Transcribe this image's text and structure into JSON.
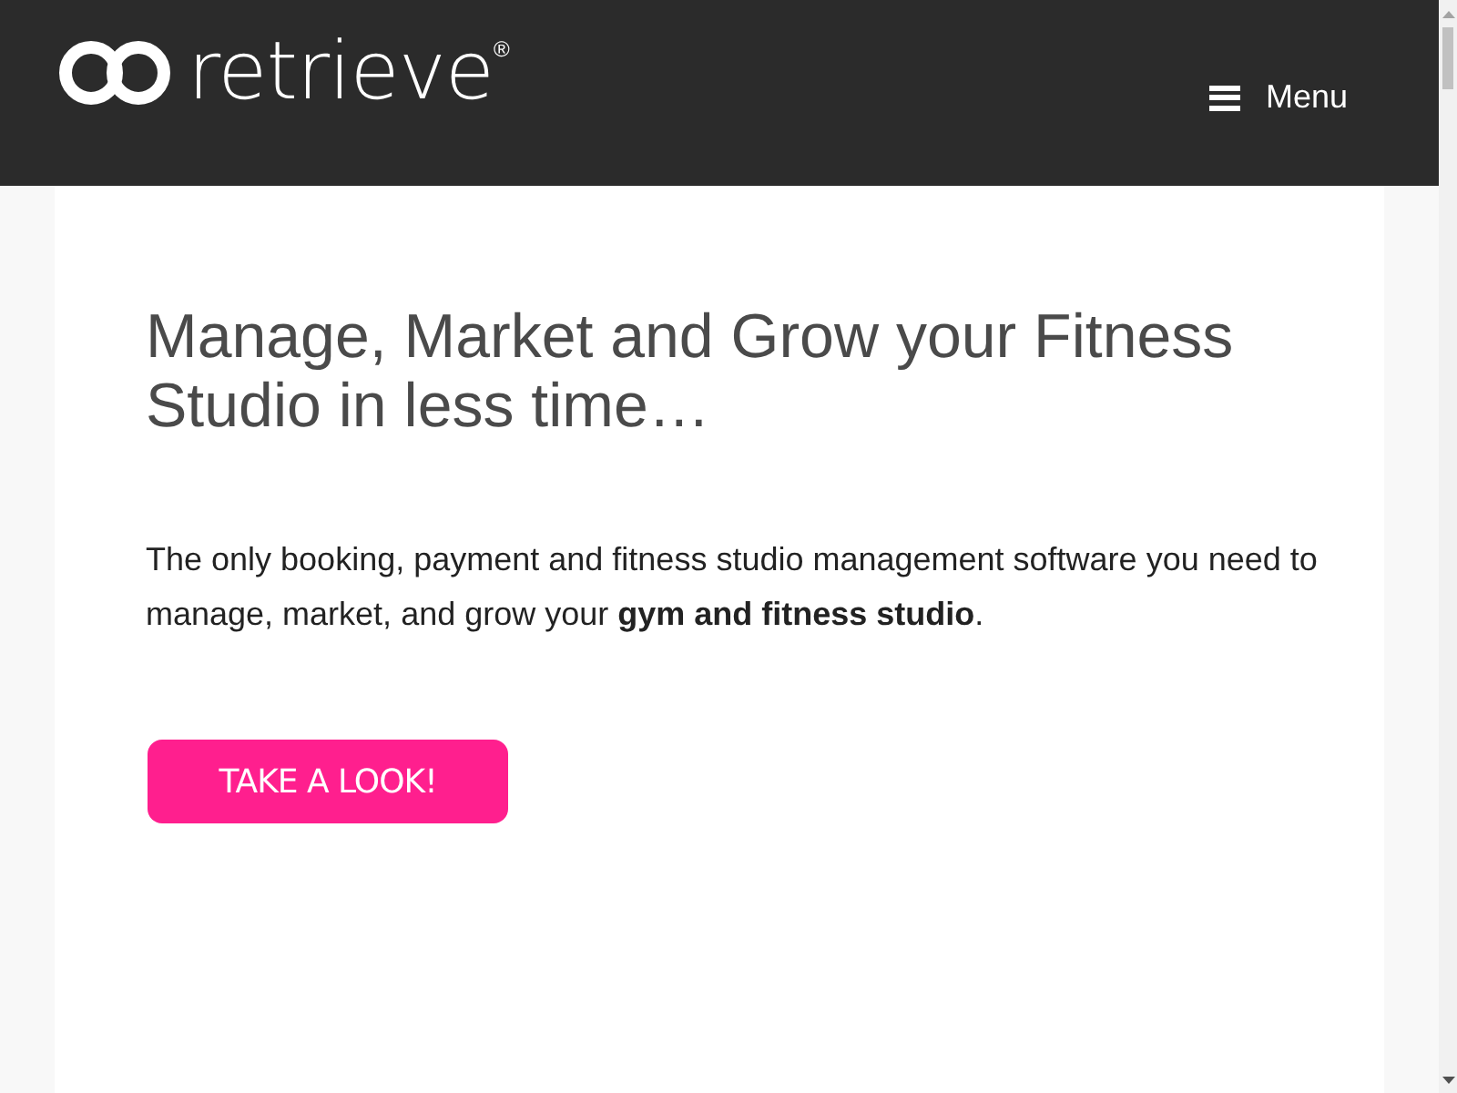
{
  "header": {
    "brand": "retrieve",
    "registered": "®",
    "menu_label": "Menu"
  },
  "hero": {
    "heading": "Manage, Market and Grow your Fitness Studio in less time…",
    "text": "The only booking, payment and fitness studio management software you need to manage, market, and grow your **gym and fitness studio**.",
    "button": "TAKE A LOOK!"
  }
}
